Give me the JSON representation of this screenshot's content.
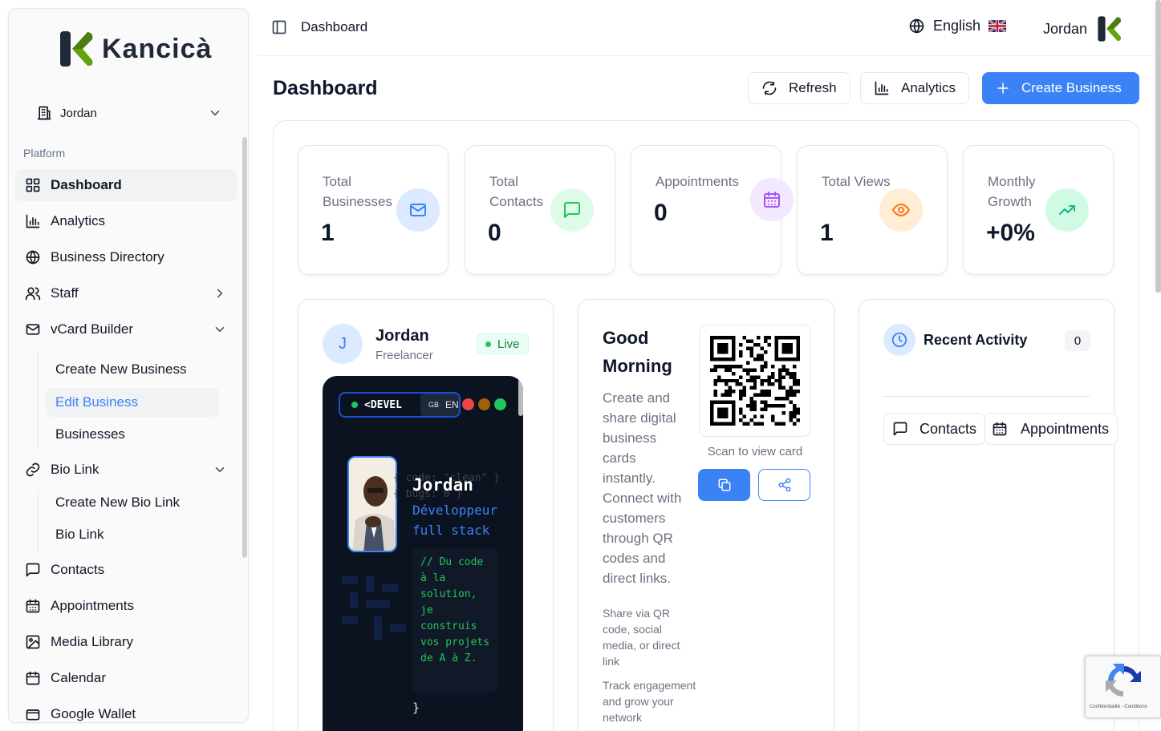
{
  "brand": {
    "name": "Kancicà"
  },
  "sidebar": {
    "org": "Jordan",
    "group_label": "Platform",
    "items": [
      {
        "label": "Dashboard"
      },
      {
        "label": "Analytics"
      },
      {
        "label": "Business Directory"
      },
      {
        "label": "Staff"
      },
      {
        "label": "vCard Builder"
      },
      {
        "label": "Bio Link"
      },
      {
        "label": "Contacts"
      },
      {
        "label": "Appointments"
      },
      {
        "label": "Media Library"
      },
      {
        "label": "Calendar"
      },
      {
        "label": "Google Wallet"
      }
    ],
    "vcard_sub": [
      {
        "label": "Create New Business"
      },
      {
        "label": "Edit Business"
      },
      {
        "label": "Businesses"
      }
    ],
    "biolink_sub": [
      {
        "label": "Create New Bio Link"
      },
      {
        "label": "Bio Link"
      }
    ]
  },
  "topbar": {
    "breadcrumb": "Dashboard",
    "language": "English",
    "user": "Jordan"
  },
  "header": {
    "title": "Dashboard",
    "refresh_label": "Refresh",
    "analytics_label": "Analytics",
    "create_label": "Create Business"
  },
  "stats": [
    {
      "label": "Total Businesses",
      "value": "1",
      "icon": "mail-icon",
      "color": "#3b82f6"
    },
    {
      "label": "Total Contacts",
      "value": "0",
      "icon": "message-icon",
      "color": "#22c55e"
    },
    {
      "label": "Appointments",
      "value": "0",
      "icon": "calendar-icon",
      "color": "#a855f7"
    },
    {
      "label": "Total Views",
      "value": "1",
      "icon": "eye-icon",
      "color": "#f97316"
    },
    {
      "label": "Monthly Growth",
      "value": "+0%",
      "icon": "trending-up-icon",
      "color": "#10b981"
    }
  ],
  "profile": {
    "initial": "J",
    "name": "Jordan",
    "role": "Freelancer",
    "status": "Live",
    "preview": {
      "dev_label": "<DEVEL",
      "lang_flag": "GB",
      "lang_code": "EN",
      "code_line1": "{ code: \"clean\" }",
      "code_line2": "{ bugs: 0 }",
      "name": "Jordan",
      "role_line1": "Développeur",
      "role_line2": "full stack",
      "comment": "// Du code à la solution, je construis vos projets de A à Z.",
      "brace": "}"
    }
  },
  "greeting": {
    "title": "Good Morning",
    "description": "Create and share digital business cards instantly. Connect with customers through QR codes and direct links.",
    "tip1": "Share via QR code, social media, or direct link",
    "tip2": "Track engagement and grow your network",
    "scan_label": "Scan to view card"
  },
  "activity": {
    "title": "Recent Activity",
    "count": "0",
    "tab_contacts": "Contacts",
    "tab_appointments": "Appointments"
  },
  "recaptcha": {
    "text": "Confidentialité - Conditions"
  }
}
